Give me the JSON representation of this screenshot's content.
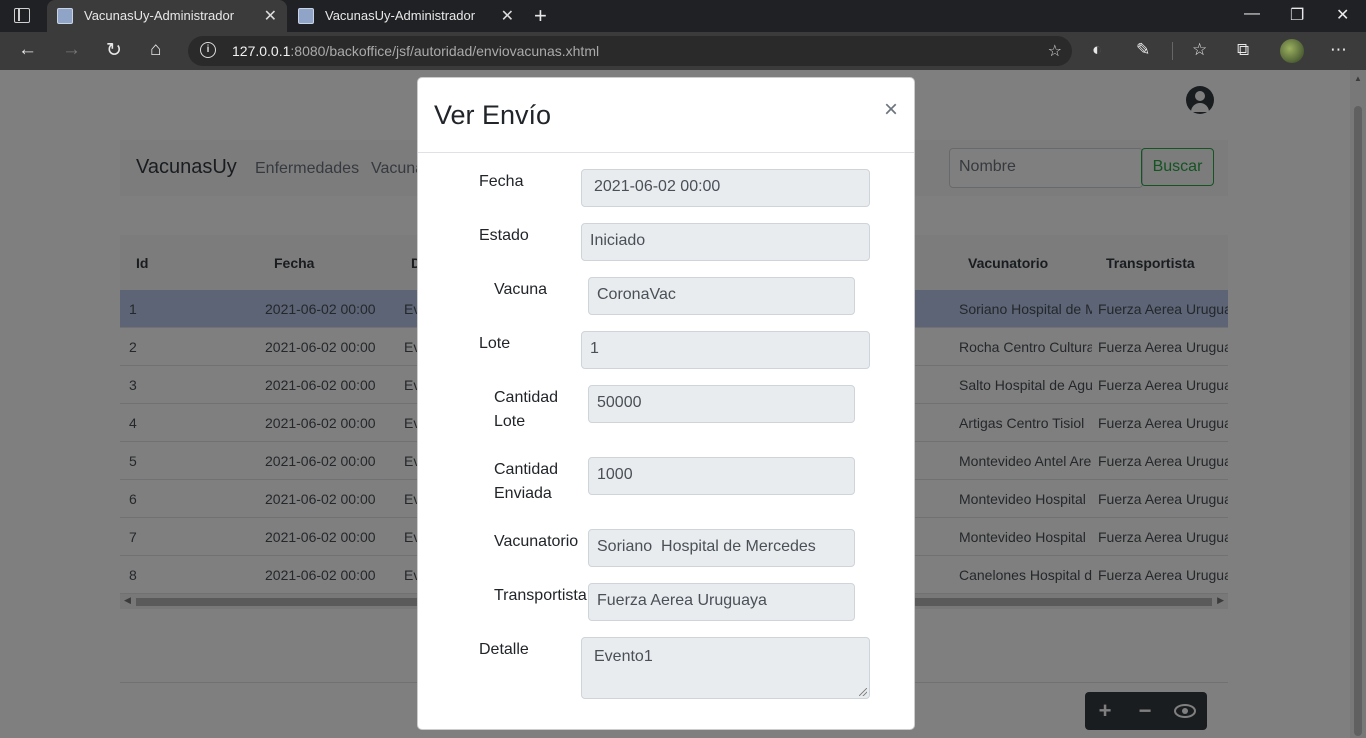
{
  "browser": {
    "tabs": [
      {
        "title": "VacunasUy-Administrador",
        "active": true
      },
      {
        "title": "VacunasUy-Administrador",
        "active": false
      }
    ],
    "url_host": "127.0.0.1",
    "url_rest": ":8080/backoffice/jsf/autoridad/enviovacunas.xhtml"
  },
  "navbar": {
    "brand": "VacunasUy",
    "links": [
      "Enfermedades",
      "Vacuna"
    ],
    "search_placeholder": "Nombre",
    "search_button": "Buscar"
  },
  "table": {
    "headers": {
      "id": "Id",
      "fecha": "Fecha",
      "d": "D",
      "vacunatorio": "Vacunatorio",
      "transportista": "Transportista"
    },
    "rows": [
      {
        "id": "1",
        "fecha": "2021-06-02 00:00",
        "ev": "Ev",
        "vacunatorio": "Soriano Hospital de M",
        "transportista": "Fuerza Aerea Uruguaya"
      },
      {
        "id": "2",
        "fecha": "2021-06-02 00:00",
        "ev": "Ev",
        "vacunatorio": "Rocha Centro Cultural",
        "transportista": "Fuerza Aerea Uruguaya"
      },
      {
        "id": "3",
        "fecha": "2021-06-02 00:00",
        "ev": "Ev",
        "vacunatorio": "Salto Hospital de Agu",
        "transportista": "Fuerza Aerea Uruguaya"
      },
      {
        "id": "4",
        "fecha": "2021-06-02 00:00",
        "ev": "Ev",
        "vacunatorio": "Artigas Centro Tisiol",
        "transportista": "Fuerza Aerea Uruguaya"
      },
      {
        "id": "5",
        "fecha": "2021-06-02 00:00",
        "ev": "Ev",
        "vacunatorio": "Montevideo Antel Are",
        "transportista": "Fuerza Aerea Uruguaya"
      },
      {
        "id": "6",
        "fecha": "2021-06-02 00:00",
        "ev": "Ev",
        "vacunatorio": "Montevideo Hospital",
        "transportista": "Fuerza Aerea Uruguaya"
      },
      {
        "id": "7",
        "fecha": "2021-06-02 00:00",
        "ev": "Ev",
        "vacunatorio": "Montevideo Hospital",
        "transportista": "Fuerza Aerea Uruguaya"
      },
      {
        "id": "8",
        "fecha": "2021-06-02 00:00",
        "ev": "Ev",
        "vacunatorio": "Canelones Hospital d",
        "transportista": "Fuerza Aerea Uruguaya"
      }
    ]
  },
  "actions": {
    "add": "+",
    "remove": "−",
    "view": "view-icon"
  },
  "modal": {
    "title": "Ver Envío",
    "close": "×",
    "fields": {
      "fecha": {
        "label": "Fecha",
        "value": "2021-06-02 00:00"
      },
      "estado": {
        "label": "Estado",
        "value": "Iniciado"
      },
      "vacuna": {
        "label": "Vacuna",
        "value": "CoronaVac"
      },
      "lote": {
        "label": "Lote",
        "value": "1"
      },
      "cantidad_lote": {
        "label_1": "Cantidad",
        "label_2": "Lote",
        "value": "50000"
      },
      "cantidad_enviada": {
        "label_1": "Cantidad",
        "label_2": "Enviada",
        "value": "1000"
      },
      "vacunatorio": {
        "label": "Vacunatorio",
        "value": "Soriano  Hospital de Mercedes"
      },
      "transportista": {
        "label": "Transportista",
        "value": "Fuerza Aerea Uruguaya"
      },
      "detalle": {
        "label": "Detalle",
        "value": "Evento1"
      }
    }
  }
}
